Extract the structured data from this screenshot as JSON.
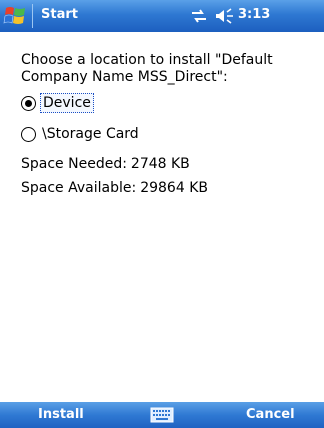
{
  "titlebar": {
    "title": "Start",
    "time": "3:13",
    "icons": [
      "windows-flag-icon",
      "connectivity-icon",
      "speaker-icon"
    ]
  },
  "installer": {
    "prompt": "Choose a location to install \"Default Company Name MSS_Direct\":",
    "options": [
      {
        "label": "Device",
        "selected": true
      },
      {
        "label": "\\Storage Card",
        "selected": false
      }
    ],
    "space_needed_label": "Space Needed:",
    "space_needed_value": "2748 KB",
    "space_available_label": "Space Available:",
    "space_available_value": "29864 KB"
  },
  "softkeys": {
    "left": "Install",
    "right": "Cancel",
    "center_icon": "keyboard-icon"
  },
  "colors": {
    "bar_blue": "#2e78d2",
    "background": "#ffffff",
    "text": "#000000"
  }
}
